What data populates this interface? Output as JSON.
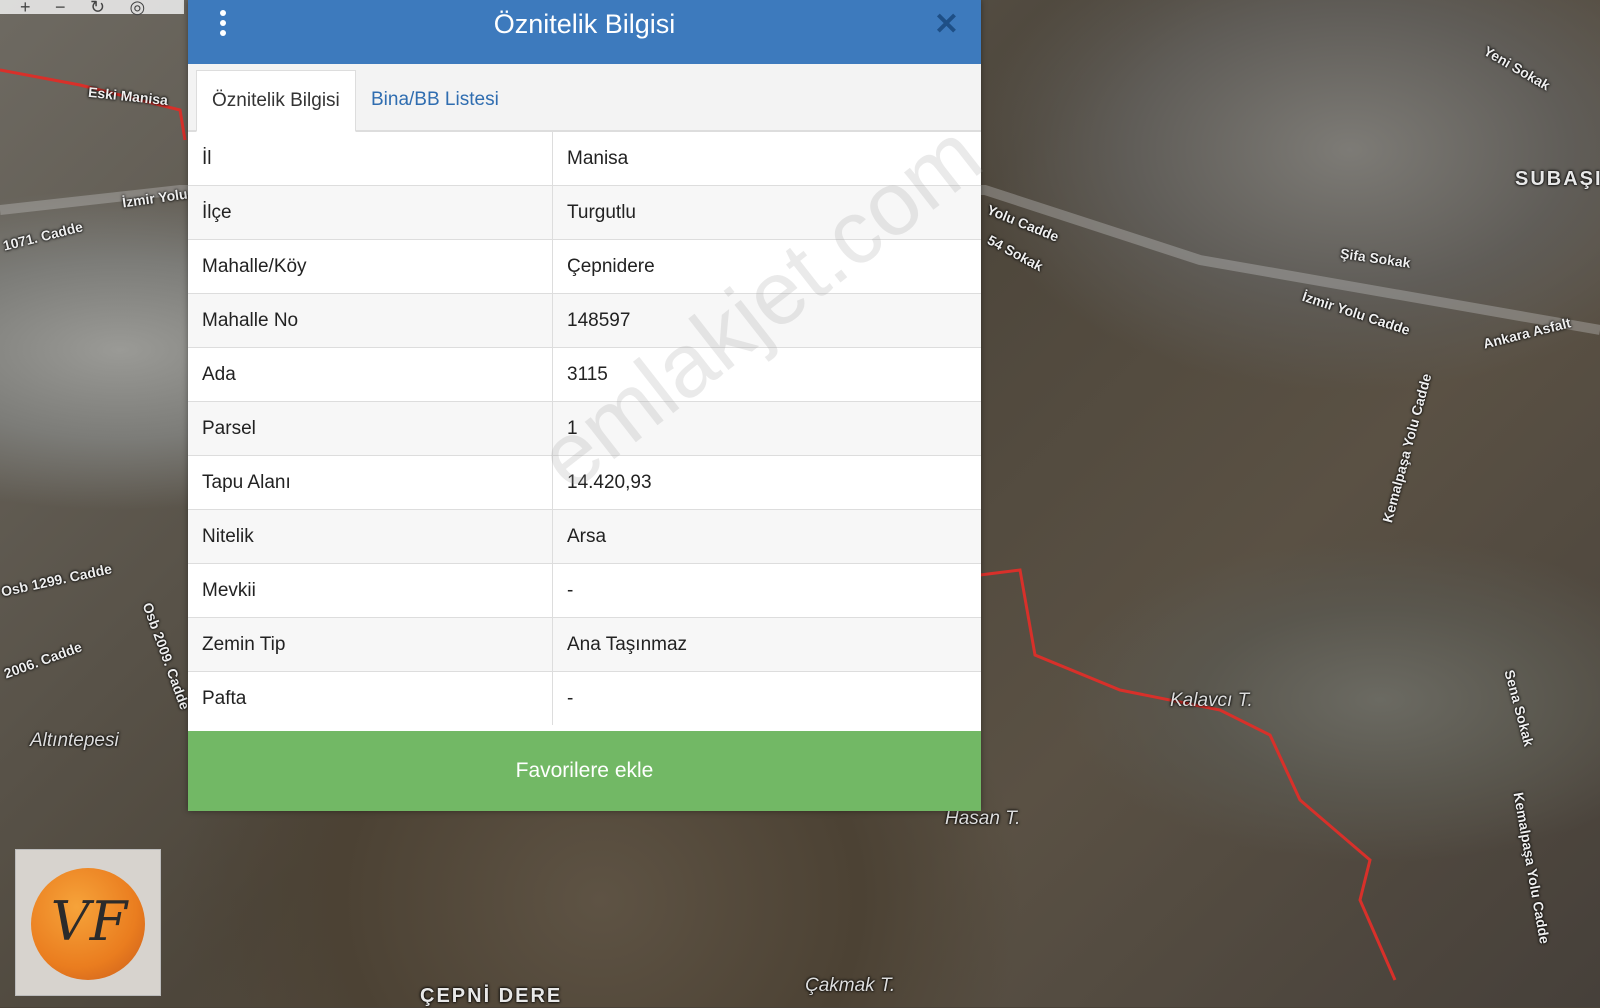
{
  "dialog": {
    "title": "Öznitelik Bilgisi",
    "close_glyph": "✕",
    "tabs": [
      {
        "label": "Öznitelik Bilgisi",
        "active": true
      },
      {
        "label": "Bina/BB Listesi",
        "active": false
      }
    ],
    "rows": [
      {
        "key": "İl",
        "value": "Manisa"
      },
      {
        "key": "İlçe",
        "value": "Turgutlu"
      },
      {
        "key": "Mahalle/Köy",
        "value": "Çepnidere"
      },
      {
        "key": "Mahalle No",
        "value": "148597"
      },
      {
        "key": "Ada",
        "value": "3115"
      },
      {
        "key": "Parsel",
        "value": "1"
      },
      {
        "key": "Tapu Alanı",
        "value": "14.420,93"
      },
      {
        "key": "Nitelik",
        "value": "Arsa"
      },
      {
        "key": "Mevkii",
        "value": "-"
      },
      {
        "key": "Zemin Tip",
        "value": "Ana Taşınmaz"
      },
      {
        "key": "Pafta",
        "value": "-"
      }
    ],
    "favorite_button": "Favorilere ekle"
  },
  "watermark": "emlakjet.com",
  "logo": {
    "text": "VF"
  },
  "map_labels": {
    "eski_manisa": "Eski Manisa",
    "izmir_yolu_left": "İzmir Yolu",
    "cadde_1071": "1071. Cadde",
    "osb_1299": "Osb 1299. Cadde",
    "cadde_2006": "2006. Cadde",
    "osb_2009": "Osb 2009. Cadde",
    "altintepesi": "Altıntepesi",
    "subasi": "SUBAŞI",
    "yolu_cadde": "Yolu Cadde",
    "sokak_54": "54 Sokak",
    "sifa_sokak": "Şifa Sokak",
    "izmir_yolu_cadde": "İzmir Yolu Cadde",
    "ankara_asfalt": "Ankara Asfalt",
    "kalavci": "Kalavcı T.",
    "hasan": "Hasan T.",
    "cakmak": "Çakmak T.",
    "cepni_dere": "ÇEPNİ DERE",
    "kemalpasa_yolu": "Kemalpaşa Yolu Cadde",
    "sena_sokak": "Sena Sokak",
    "yeni_sokak": "Yeni Sokak"
  },
  "colors": {
    "header": "#3d7abd",
    "button": "#72b865",
    "tab_link": "#2f6db0",
    "boundary": "#d8302a"
  }
}
